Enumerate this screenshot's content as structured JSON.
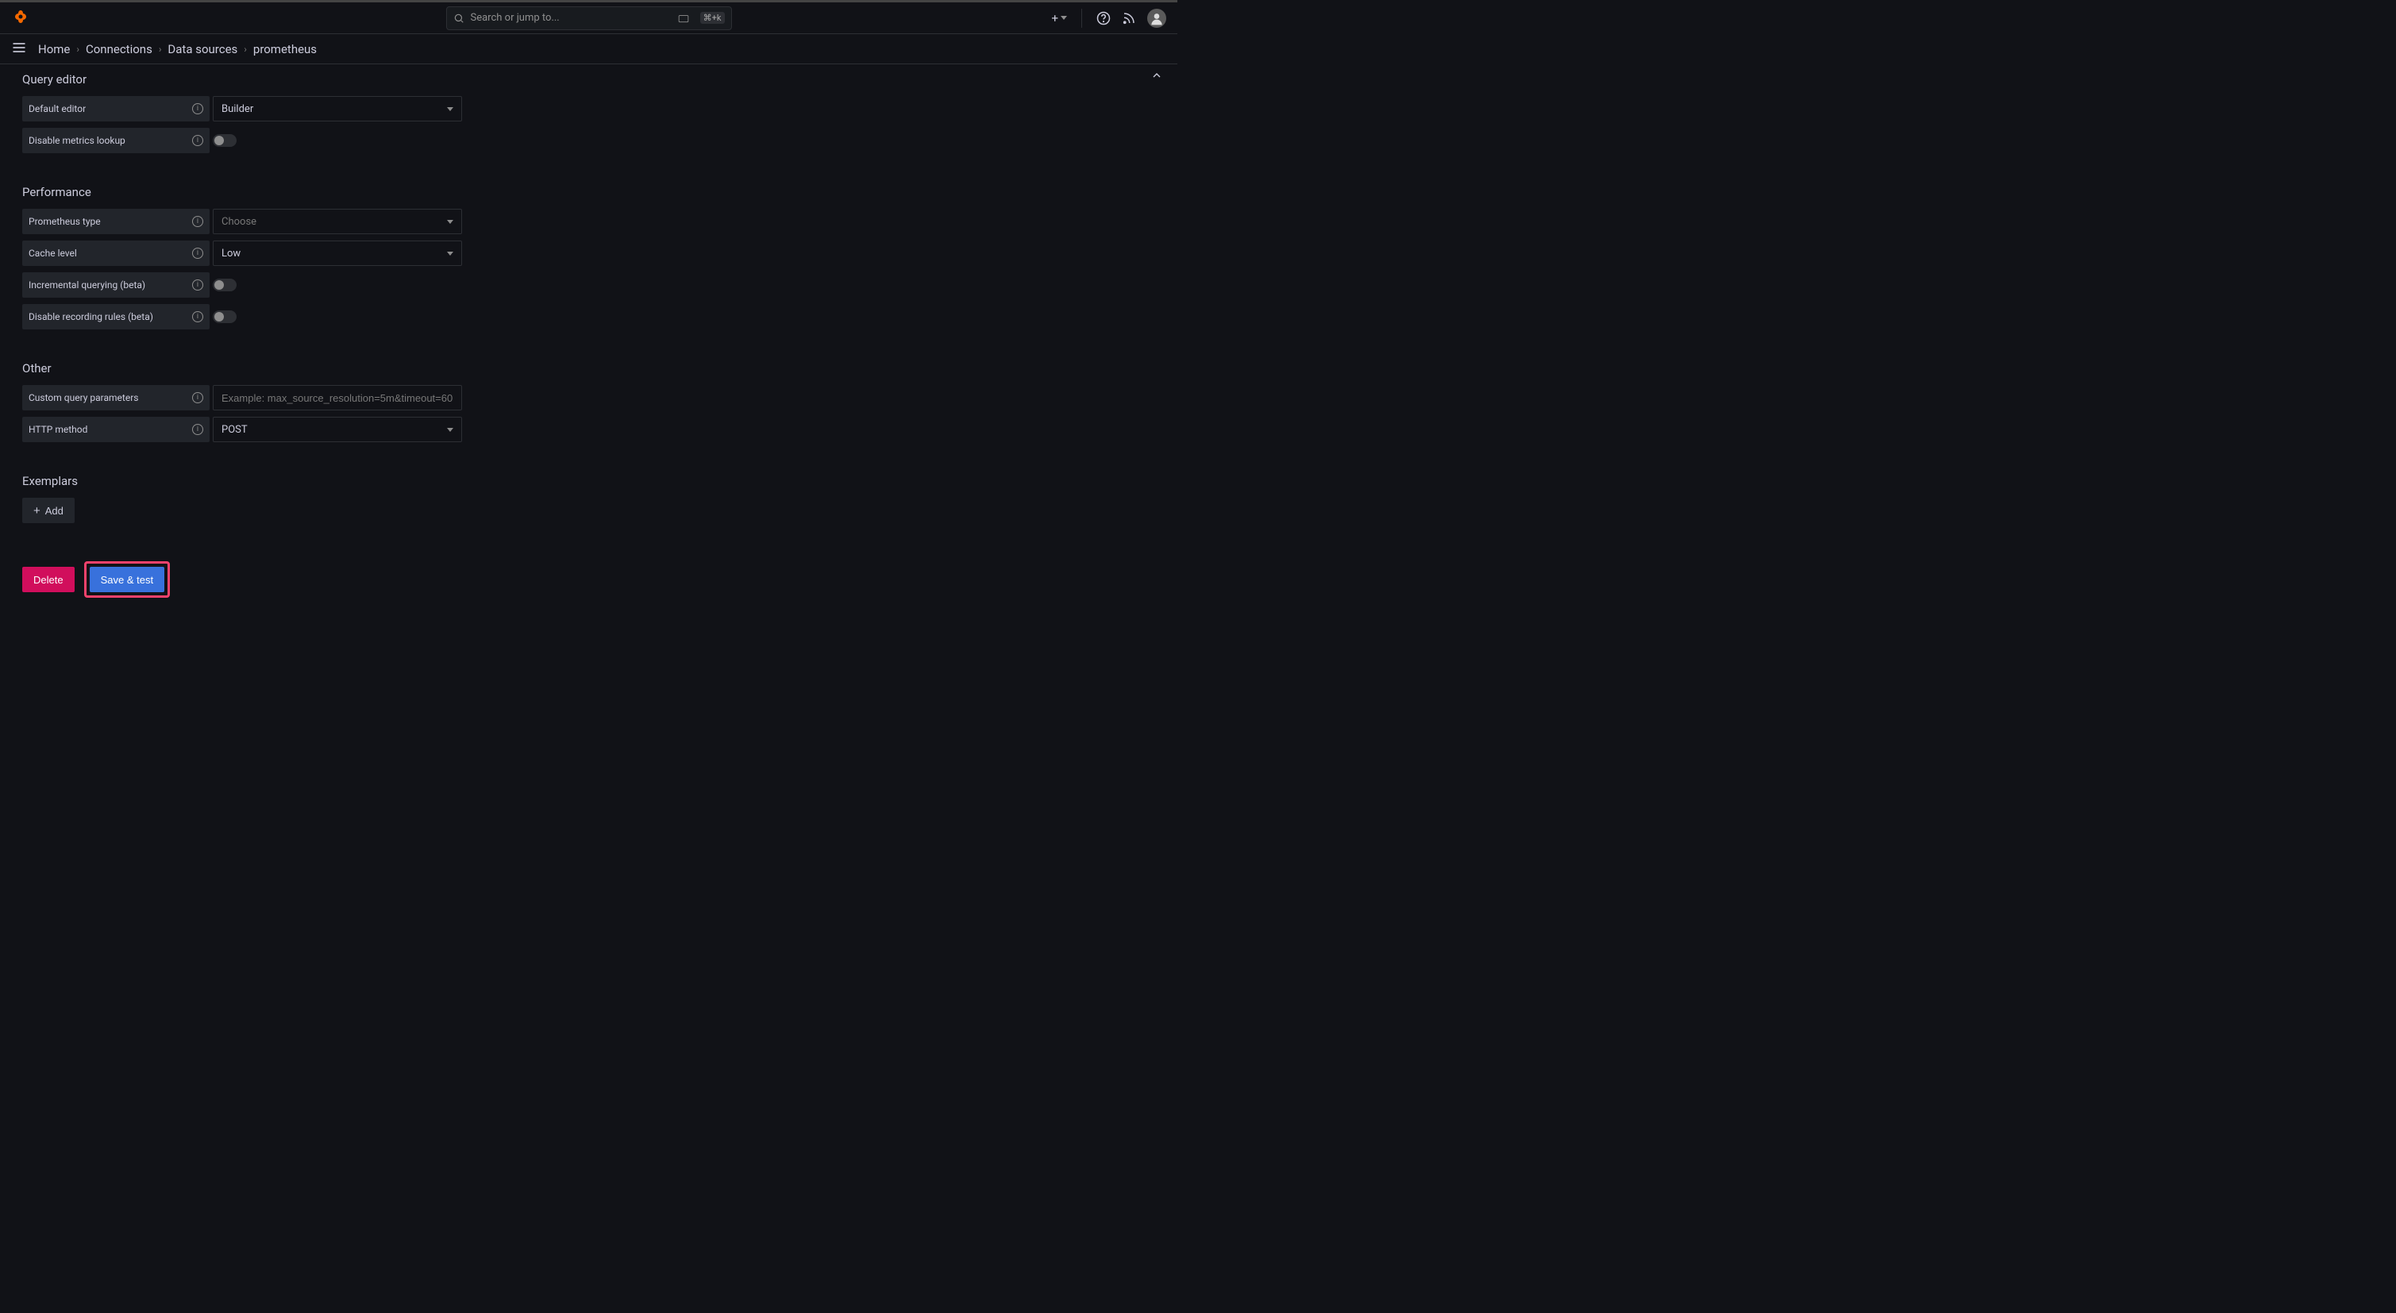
{
  "topbar": {
    "search_placeholder": "Search or jump to...",
    "kbd_hint": "⌘+k"
  },
  "breadcrumbs": {
    "items": [
      "Home",
      "Connections",
      "Data sources",
      "prometheus"
    ]
  },
  "sections": {
    "query_editor": {
      "title": "Query editor",
      "default_editor_label": "Default editor",
      "default_editor_value": "Builder",
      "disable_metrics_label": "Disable metrics lookup"
    },
    "performance": {
      "title": "Performance",
      "prometheus_type_label": "Prometheus type",
      "prometheus_type_value": "Choose",
      "cache_level_label": "Cache level",
      "cache_level_value": "Low",
      "incremental_label": "Incremental querying (beta)",
      "disable_recording_label": "Disable recording rules (beta)"
    },
    "other": {
      "title": "Other",
      "custom_query_label": "Custom query parameters",
      "custom_query_placeholder": "Example: max_source_resolution=5m&timeout=60",
      "http_method_label": "HTTP method",
      "http_method_value": "POST"
    },
    "exemplars": {
      "title": "Exemplars",
      "add_label": "Add"
    }
  },
  "actions": {
    "delete": "Delete",
    "save_test": "Save & test"
  }
}
